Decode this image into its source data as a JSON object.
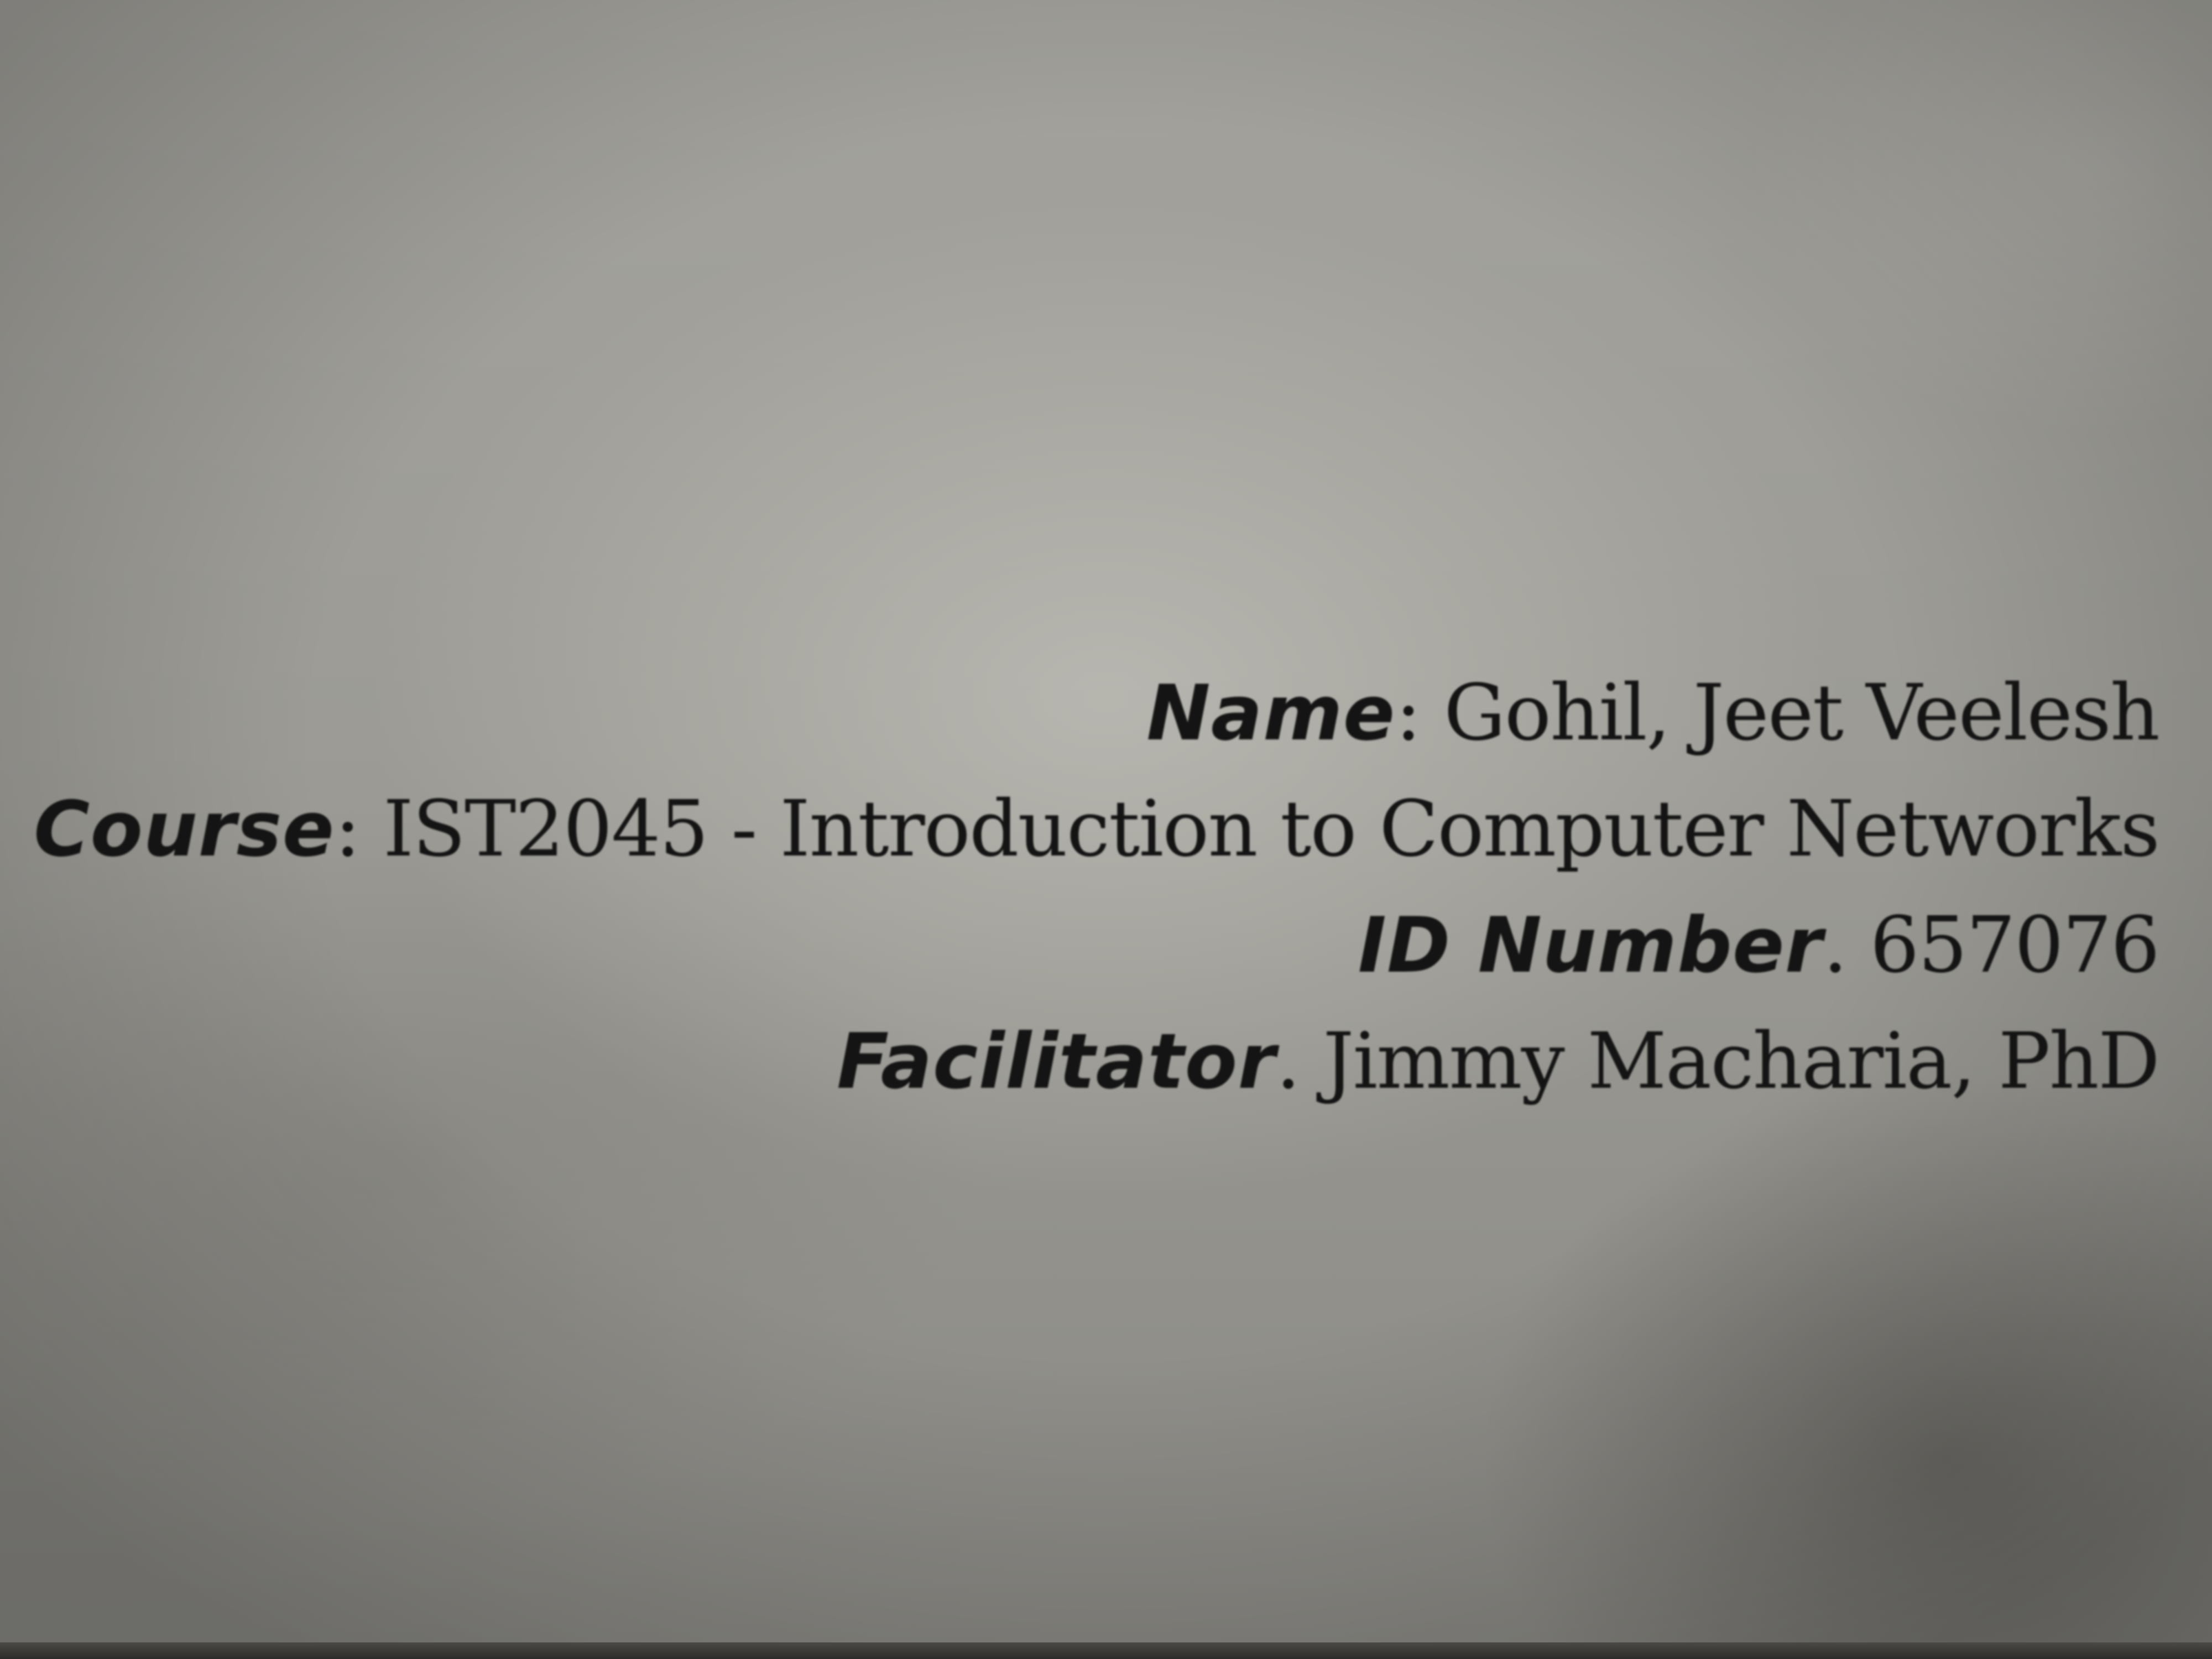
{
  "document": {
    "fields": [
      {
        "label": "Name",
        "separator": ": ",
        "value": "Gohil, Jeet Veelesh"
      },
      {
        "label": "Course",
        "separator": ": ",
        "value": "IST2045 - Introduction to Computer Networks"
      },
      {
        "label": "ID Number",
        "separator": ". ",
        "value": "657076"
      },
      {
        "label": "Facilitator",
        "separator": ". ",
        "value": "Jimmy Macharia, PhD"
      }
    ]
  }
}
